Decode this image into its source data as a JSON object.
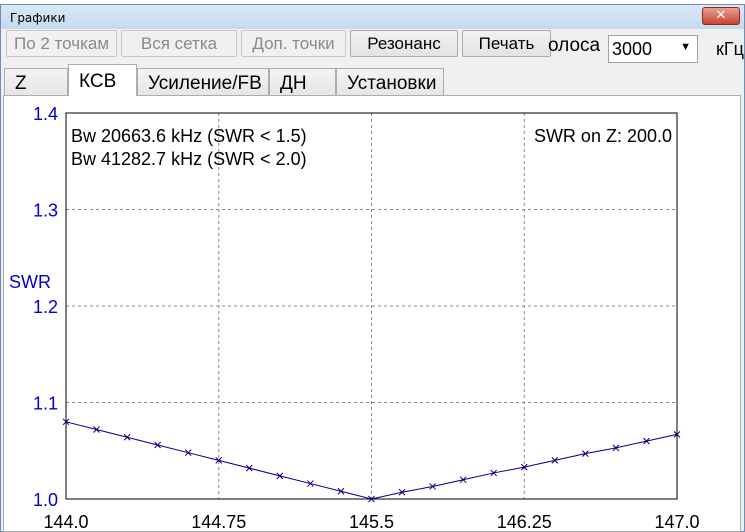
{
  "window": {
    "title": "Графики",
    "close_glyph": "✕"
  },
  "toolbar": {
    "buttons": [
      {
        "label": "По 2 точкам",
        "enabled": false
      },
      {
        "label": "Вся сетка",
        "enabled": false
      },
      {
        "label": "Доп. точки",
        "enabled": false
      },
      {
        "label": "Резонанс",
        "enabled": true
      },
      {
        "label": "Печать",
        "enabled": true
      }
    ],
    "band_label": "олоса",
    "band_value": "3000",
    "unit_label": "кГц"
  },
  "tabs": [
    {
      "label": "Z",
      "active": false
    },
    {
      "label": "КСВ",
      "active": true
    },
    {
      "label": "Усиление/FB",
      "active": false
    },
    {
      "label": "ДН",
      "active": false
    },
    {
      "label": "Установки",
      "active": false
    }
  ],
  "chart_data": {
    "type": "line",
    "ylabel": "SWR",
    "xlabel": "",
    "xlim": [
      144.0,
      147.0
    ],
    "ylim": [
      1.0,
      1.4
    ],
    "x_ticks": [
      "144.0",
      "144.75",
      "145.5",
      "146.25",
      "147.0"
    ],
    "y_ticks": [
      "1.0",
      "1.1",
      "1.2",
      "1.3",
      "1.4"
    ],
    "grid": true,
    "annotations": {
      "bw1": "Bw 20663.6 kHz (SWR < 1.5)",
      "bw2": "Bw 41282.7 kHz (SWR < 2.0)",
      "swr_on_z": "SWR on Z: 200.0"
    },
    "series": [
      {
        "color": "#000080",
        "x": [
          144.0,
          144.15,
          144.3,
          144.45,
          144.6,
          144.75,
          144.9,
          145.05,
          145.2,
          145.35,
          145.5,
          145.65,
          145.8,
          145.95,
          146.1,
          146.25,
          146.4,
          146.55,
          146.7,
          146.85,
          147.0
        ],
        "y": [
          1.08,
          1.072,
          1.064,
          1.056,
          1.048,
          1.04,
          1.032,
          1.024,
          1.016,
          1.008,
          1.0,
          1.007,
          1.013,
          1.02,
          1.027,
          1.033,
          1.04,
          1.047,
          1.053,
          1.06,
          1.067
        ]
      }
    ]
  }
}
